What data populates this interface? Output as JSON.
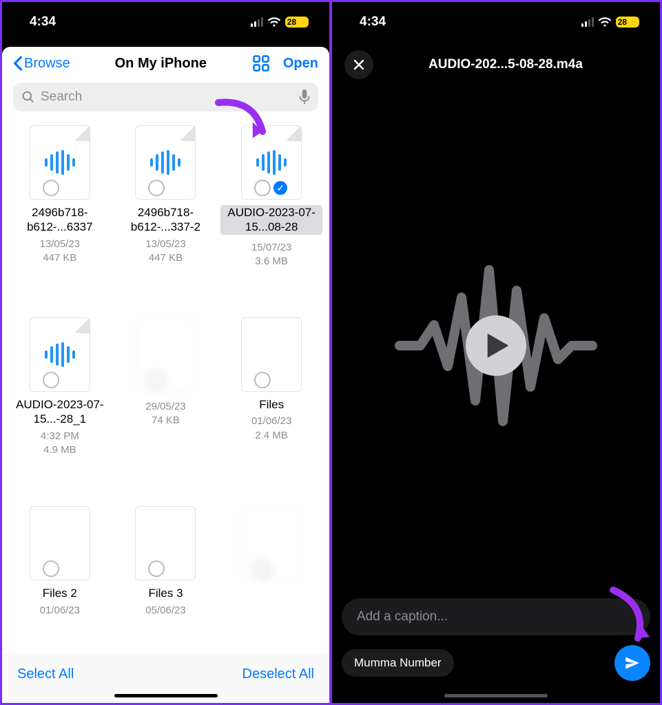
{
  "status": {
    "time": "4:34",
    "battery": "28"
  },
  "left": {
    "back_label": "Browse",
    "title": "On My iPhone",
    "open_label": "Open",
    "search_placeholder": "Search",
    "select_all": "Select All",
    "deselect_all": "Deselect All",
    "files": [
      {
        "name": "2496b718-b612-...6337",
        "date": "13/05/23",
        "size": "447 KB",
        "type": "audio"
      },
      {
        "name": "2496b718-b612-...337-2",
        "date": "13/05/23",
        "size": "447 KB",
        "type": "audio"
      },
      {
        "name": "AUDIO-2023-07-15...08-28",
        "date": "15/07/23",
        "size": "3.6 MB",
        "type": "audio",
        "selected": true
      },
      {
        "name": "AUDIO-2023-07-15...-28_1",
        "date": "4:32 PM",
        "size": "4.9 MB",
        "type": "audio"
      },
      {
        "name": "",
        "date": "29/05/23",
        "size": "74 KB",
        "type": "doc",
        "blurred": true
      },
      {
        "name": "Files",
        "date": "01/06/23",
        "size": "2.4 MB",
        "type": "doc"
      },
      {
        "name": "Files 2",
        "date": "01/06/23",
        "size": "",
        "type": "doc"
      },
      {
        "name": "Files 3",
        "date": "05/06/23",
        "size": "",
        "type": "doc"
      },
      {
        "name": "",
        "date": "",
        "size": "",
        "type": "doc",
        "blurred": true
      }
    ]
  },
  "right": {
    "title": "AUDIO-202...5-08-28.m4a",
    "caption_placeholder": "Add a caption...",
    "recipient": "Mumma Number"
  }
}
